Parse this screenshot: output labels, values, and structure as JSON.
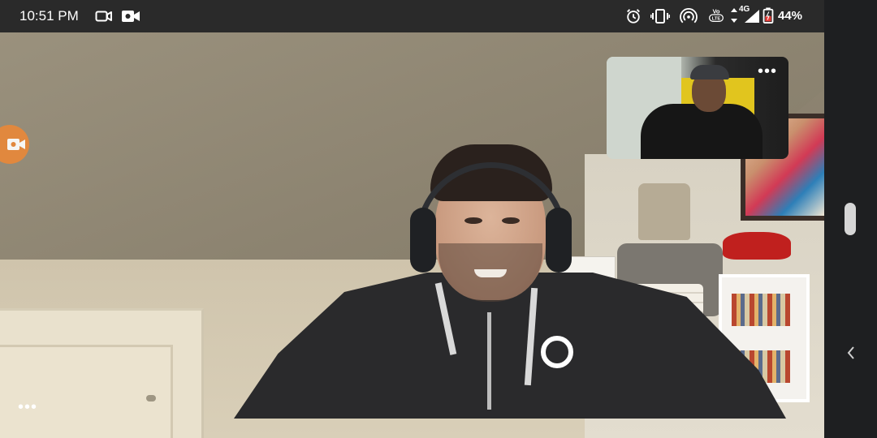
{
  "status_bar": {
    "time": "10:51 PM",
    "network_label": "4G",
    "volte_label": "Vo LTE",
    "battery_percent": "44%",
    "icons": [
      "video-camera-outline-icon",
      "video-camera-filled-icon",
      "alarm-icon",
      "vibrate-icon",
      "hotspot-icon",
      "volte-icon",
      "data-arrows-icon",
      "signal-icon",
      "battery-icon"
    ]
  },
  "pip": {
    "menu_label": "•••"
  },
  "main": {
    "more_label": "•••"
  },
  "nav": {
    "back_label": "‹"
  },
  "colors": {
    "record_button": "#e8883a",
    "status_bar_bg": "#2a2a2a",
    "nav_bar_bg": "#1e1f21"
  }
}
